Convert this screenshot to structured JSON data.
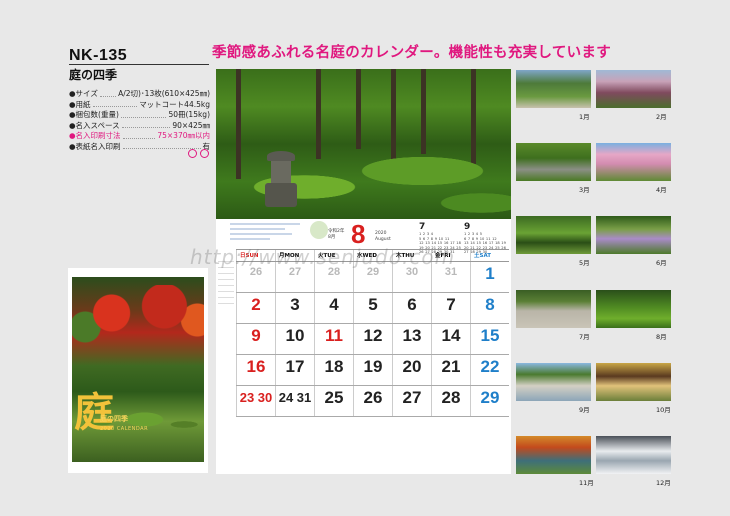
{
  "product": {
    "code": "NK-135",
    "name": "庭の四季"
  },
  "specs": [
    {
      "label": "●サイズ",
      "value": "A/2切)･13枚(610×425㎜)",
      "highlight": false
    },
    {
      "label": "●用紙",
      "value": "マットコート44.5kg",
      "highlight": false
    },
    {
      "label": "●梱包数(重量)",
      "value": "50冊(15kg)",
      "highlight": false
    },
    {
      "label": "●名入スペース",
      "value": "90×425㎜",
      "highlight": false
    },
    {
      "label": "●名入印刷寸法",
      "value": "75×370㎜以内",
      "highlight": true
    },
    {
      "label": "●表紙名入印刷",
      "value": "有",
      "highlight": false
    }
  ],
  "headline": "季節感あふれる名庭のカレンダー。機能性も充実しています",
  "cover": {
    "big_char": "庭",
    "title": "庭の四季",
    "subtitle": "2020 CALENDAR"
  },
  "watermark": "http://www.senjudo.com",
  "calendar": {
    "era": "令和2年",
    "era_sub": "8月",
    "month": "8",
    "year": "2020",
    "month_en": "August",
    "prev_month": {
      "num": "7",
      "rows": [
        "1 2 3 4",
        "5 6 7 8 9 10 11",
        "12 13 14 15 16 17 18",
        "19 20 21 22 23 24 25",
        "26 27 28 29 30 31"
      ]
    },
    "next_month": {
      "num": "9",
      "rows": [
        "1 2 3 4 5",
        "6 7 8 9 10 11 12",
        "13 14 15 16 17 18 19",
        "20 21 22 23 24 25 26",
        "27 28 29 30"
      ]
    },
    "weekdays": [
      "日SUN",
      "月MON",
      "火TUE",
      "水WED",
      "木THU",
      "金FRI",
      "土SAT"
    ],
    "weeks": [
      [
        {
          "n": "26",
          "t": "prev"
        },
        {
          "n": "27",
          "t": "prev"
        },
        {
          "n": "28",
          "t": "prev"
        },
        {
          "n": "29",
          "t": "prev"
        },
        {
          "n": "30",
          "t": "prev"
        },
        {
          "n": "31",
          "t": "prev"
        },
        {
          "n": "1",
          "t": "sat"
        }
      ],
      [
        {
          "n": "2",
          "t": "sun"
        },
        {
          "n": "3",
          "t": ""
        },
        {
          "n": "4",
          "t": ""
        },
        {
          "n": "5",
          "t": ""
        },
        {
          "n": "6",
          "t": ""
        },
        {
          "n": "7",
          "t": ""
        },
        {
          "n": "8",
          "t": "sat"
        }
      ],
      [
        {
          "n": "9",
          "t": "sun"
        },
        {
          "n": "10",
          "t": ""
        },
        {
          "n": "11",
          "t": "hol"
        },
        {
          "n": "12",
          "t": ""
        },
        {
          "n": "13",
          "t": ""
        },
        {
          "n": "14",
          "t": ""
        },
        {
          "n": "15",
          "t": "sat"
        }
      ],
      [
        {
          "n": "16",
          "t": "sun"
        },
        {
          "n": "17",
          "t": ""
        },
        {
          "n": "18",
          "t": ""
        },
        {
          "n": "19",
          "t": ""
        },
        {
          "n": "20",
          "t": ""
        },
        {
          "n": "21",
          "t": ""
        },
        {
          "n": "22",
          "t": "sat"
        }
      ],
      [
        {
          "n": "23 30",
          "t": "split-sun"
        },
        {
          "n": "24 31",
          "t": "split"
        },
        {
          "n": "25",
          "t": ""
        },
        {
          "n": "26",
          "t": ""
        },
        {
          "n": "27",
          "t": ""
        },
        {
          "n": "28",
          "t": ""
        },
        {
          "n": "29",
          "t": "sat"
        }
      ]
    ]
  },
  "months": [
    {
      "label": "1月",
      "slot": "t1"
    },
    {
      "label": "2月",
      "slot": "t2"
    },
    {
      "label": "3月",
      "slot": "t3"
    },
    {
      "label": "4月",
      "slot": "t4"
    },
    {
      "label": "5月",
      "slot": "t5"
    },
    {
      "label": "6月",
      "slot": "t6"
    },
    {
      "label": "7月",
      "slot": "t7"
    },
    {
      "label": "8月",
      "slot": "t8"
    },
    {
      "label": "9月",
      "slot": "t9"
    },
    {
      "label": "10月",
      "slot": "t10"
    },
    {
      "label": "11月",
      "slot": "t11"
    },
    {
      "label": "12月",
      "slot": "t12"
    }
  ],
  "colors": {
    "accent_pink": "#e0187f",
    "sunday_red": "#d9201f",
    "saturday_blue": "#1f7fc9"
  }
}
